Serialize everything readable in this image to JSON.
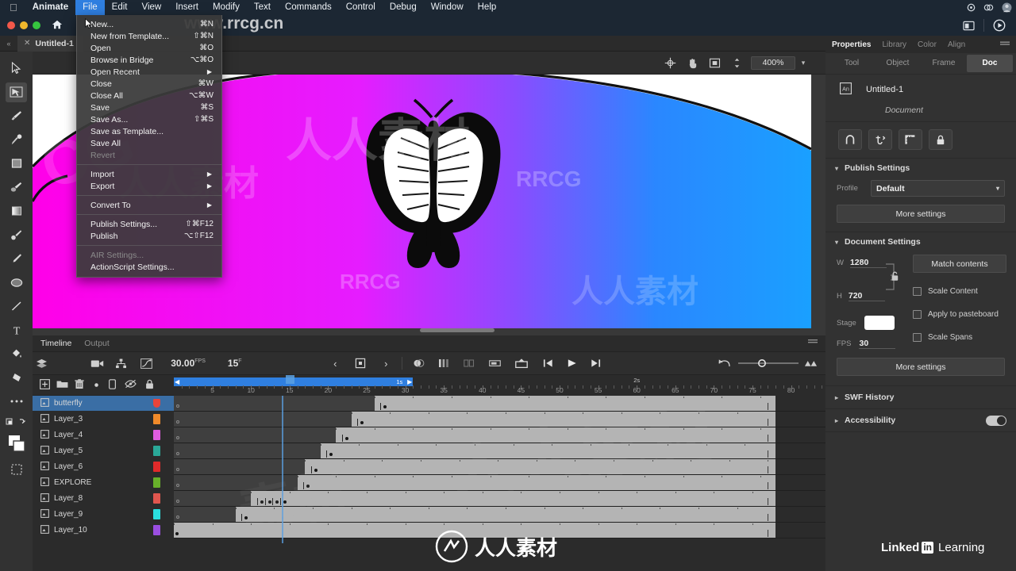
{
  "menubar": {
    "apple_icon": "apple-icon",
    "items": [
      {
        "label": "Animate",
        "bold": true,
        "active": false
      },
      {
        "label": "File",
        "bold": false,
        "active": true
      },
      {
        "label": "Edit",
        "bold": false,
        "active": false
      },
      {
        "label": "View",
        "bold": false,
        "active": false
      },
      {
        "label": "Insert",
        "bold": false,
        "active": false
      },
      {
        "label": "Modify",
        "bold": false,
        "active": false
      },
      {
        "label": "Text",
        "bold": false,
        "active": false
      },
      {
        "label": "Commands",
        "bold": false,
        "active": false
      },
      {
        "label": "Control",
        "bold": false,
        "active": false
      },
      {
        "label": "Debug",
        "bold": false,
        "active": false
      },
      {
        "label": "Window",
        "bold": false,
        "active": false
      },
      {
        "label": "Help",
        "bold": false,
        "active": false
      }
    ],
    "system_icons": [
      "sync-icon",
      "creative-cloud-icon",
      "user-avatar-icon"
    ]
  },
  "file_menu": {
    "items": [
      {
        "label": "New...",
        "shortcut": "⌘N",
        "dim": false,
        "submenu": false,
        "sep_after": false
      },
      {
        "label": "New from Template...",
        "shortcut": "⇧⌘N",
        "dim": false,
        "submenu": false,
        "sep_after": false
      },
      {
        "label": "Open",
        "shortcut": "⌘O",
        "dim": false,
        "submenu": false,
        "sep_after": false
      },
      {
        "label": "Browse in Bridge",
        "shortcut": "⌥⌘O",
        "dim": false,
        "submenu": false,
        "sep_after": false
      },
      {
        "label": "Open Recent",
        "shortcut": "",
        "dim": false,
        "submenu": true,
        "sep_after": false
      },
      {
        "label": "Close",
        "shortcut": "⌘W",
        "dim": false,
        "submenu": false,
        "sep_after": false
      },
      {
        "label": "Close All",
        "shortcut": "⌥⌘W",
        "dim": false,
        "submenu": false,
        "sep_after": false
      },
      {
        "label": "Save",
        "shortcut": "⌘S",
        "dim": false,
        "submenu": false,
        "sep_after": false
      },
      {
        "label": "Save As...",
        "shortcut": "⇧⌘S",
        "dim": false,
        "submenu": false,
        "sep_after": false
      },
      {
        "label": "Save as Template...",
        "shortcut": "",
        "dim": false,
        "submenu": false,
        "sep_after": false
      },
      {
        "label": "Save All",
        "shortcut": "",
        "dim": false,
        "submenu": false,
        "sep_after": false
      },
      {
        "label": "Revert",
        "shortcut": "",
        "dim": true,
        "submenu": false,
        "sep_after": true
      },
      {
        "label": "Import",
        "shortcut": "",
        "dim": false,
        "submenu": true,
        "sep_after": false
      },
      {
        "label": "Export",
        "shortcut": "",
        "dim": false,
        "submenu": true,
        "sep_after": true
      },
      {
        "label": "Convert To",
        "shortcut": "",
        "dim": false,
        "submenu": true,
        "sep_after": true
      },
      {
        "label": "Publish Settings...",
        "shortcut": "⇧⌘F12",
        "dim": false,
        "submenu": false,
        "sep_after": false
      },
      {
        "label": "Publish",
        "shortcut": "⌥⇧F12",
        "dim": false,
        "submenu": false,
        "sep_after": true
      },
      {
        "label": "AIR Settings...",
        "shortcut": "",
        "dim": true,
        "submenu": false,
        "sep_after": false
      },
      {
        "label": "ActionScript Settings...",
        "shortcut": "",
        "dim": false,
        "submenu": false,
        "sep_after": false
      }
    ]
  },
  "appbar": {
    "home_icon": "home-icon",
    "right_icons": [
      "layout-switch-icon",
      "test-movie-play-icon"
    ]
  },
  "doc_tab": {
    "close_icon": "close-icon",
    "title": "Untitled-1"
  },
  "tools": [
    {
      "name": "selection-tool-icon",
      "selected": false
    },
    {
      "name": "free-transform-tool-icon",
      "selected": true
    },
    {
      "name": "brush-tool-icon",
      "selected": false
    },
    {
      "name": "fluid-brush-tool-icon",
      "selected": false
    },
    {
      "name": "rectangle-tool-icon",
      "selected": false
    },
    {
      "name": "paint-brush-tool-icon",
      "selected": false
    },
    {
      "name": "gradient-rect-tool-icon",
      "selected": false
    },
    {
      "name": "classic-brush-tool-icon",
      "selected": false
    },
    {
      "name": "pencil-tool-icon",
      "selected": false
    },
    {
      "name": "oval-tool-icon",
      "selected": false
    },
    {
      "name": "line-tool-icon",
      "selected": false
    },
    {
      "name": "text-tool-icon",
      "selected": false
    },
    {
      "name": "paint-bucket-tool-icon",
      "selected": false
    },
    {
      "name": "eraser-tool-icon",
      "selected": false
    },
    {
      "name": "more-tools-icon",
      "selected": false
    },
    {
      "name": "swap-colors-icon",
      "selected": false
    },
    {
      "name": "fill-stroke-color-icon",
      "selected": false
    },
    {
      "name": "crop-stage-icon",
      "selected": false
    }
  ],
  "stage_toolbar": {
    "icons": [
      "center-stage-icon",
      "hand-tool-icon",
      "fit-stage-icon",
      "zoom-stepper-icon"
    ],
    "zoom_value": "400%",
    "zoom_caret": "chevron-down-icon"
  },
  "timeline": {
    "tabs": [
      {
        "label": "Timeline",
        "active": true
      },
      {
        "label": "Output",
        "active": false
      }
    ],
    "header_icons_left": [
      "layer-parenting-icon",
      "camera-icon",
      "layer-depth-icon",
      "graph-editor-icon"
    ],
    "fps_value": "30.00",
    "fps_suffix": "FPS",
    "current_frame": "15",
    "frame_suffix": "F",
    "nav_icons": [
      "previous-keyframe-icon",
      "insert-keyframe-icon",
      "next-keyframe-icon"
    ],
    "onion_icons": [
      "onion-skin-icon",
      "onion-skin-outline-icon",
      "edit-multiple-frames-icon",
      "modify-onion-markers-icon",
      "loop-playback-icon"
    ],
    "playback_icons": [
      "step-back-icon",
      "play-icon",
      "step-forward-icon"
    ],
    "right_icons": [
      "reset-timeline-icon",
      "frame-size-slider-icon",
      "resize-frames-icon"
    ],
    "layer_tool_icons": [
      "add-layer-icon",
      "new-folder-icon",
      "delete-layer-icon",
      "layer-dot-icon",
      "layer-display-icon",
      "hide-layer-icon",
      "lock-layer-icon"
    ],
    "scrub_range_label": "1s",
    "second_marker_label": "2s",
    "ruler_numbers": [
      5,
      10,
      15,
      20,
      25,
      30,
      35,
      40,
      45,
      50,
      55,
      60,
      65,
      70,
      75,
      80
    ],
    "layers": [
      {
        "name": "butterfly",
        "color": "#e8443a",
        "selected": true,
        "fill_start": 27,
        "keyframes": [
          28
        ]
      },
      {
        "name": "Layer_3",
        "color": "#f08a2a",
        "selected": false,
        "fill_start": 24,
        "keyframes": [
          25
        ]
      },
      {
        "name": "Layer_4",
        "color": "#e05ce0",
        "selected": false,
        "fill_start": 22,
        "keyframes": [
          23
        ]
      },
      {
        "name": "Layer_5",
        "color": "#2aa898",
        "selected": false,
        "fill_start": 20,
        "keyframes": [
          21
        ]
      },
      {
        "name": "Layer_6",
        "color": "#e02a2a",
        "selected": false,
        "fill_start": 18,
        "keyframes": [
          19
        ]
      },
      {
        "name": "EXPLORE",
        "color": "#68b02a",
        "selected": false,
        "fill_start": 17,
        "keyframes": [
          18
        ]
      },
      {
        "name": "Layer_8",
        "color": "#e0564e",
        "selected": false,
        "fill_start": 11,
        "keyframes": [
          12,
          13,
          14,
          15
        ]
      },
      {
        "name": "Layer_9",
        "color": "#2ae0e0",
        "selected": false,
        "fill_start": 9,
        "keyframes": [
          10
        ]
      },
      {
        "name": "Layer_10",
        "color": "#9a4ee0",
        "selected": false,
        "fill_start": 1,
        "keyframes": [
          1
        ]
      }
    ],
    "fill_end_frame": 78,
    "playhead_frame": 15
  },
  "properties": {
    "panel_tabs": [
      {
        "label": "Properties",
        "active": true
      },
      {
        "label": "Library",
        "active": false
      },
      {
        "label": "Color",
        "active": false
      },
      {
        "label": "Align",
        "active": false
      }
    ],
    "menu_icon": "panel-menu-icon",
    "object_tabs": [
      {
        "label": "Tool",
        "active": false
      },
      {
        "label": "Object",
        "active": false
      },
      {
        "label": "Frame",
        "active": false
      },
      {
        "label": "Doc",
        "active": true
      }
    ],
    "doc_icon": "animate-document-icon",
    "doc_name": "Untitled-1",
    "doc_subtitle": "Document",
    "quick_icons": [
      "snap-to-objects-icon",
      "edit-snapping-icon",
      "show-rulers-icon",
      "lock-guides-icon"
    ],
    "publish_settings": {
      "title": "Publish Settings",
      "chevron": "chevron-down-icon",
      "profile_label": "Profile",
      "profile_value": "Default",
      "profile_caret": "chevron-down-icon",
      "more_settings_label": "More settings"
    },
    "document_settings": {
      "title": "Document Settings",
      "chevron": "chevron-down-icon",
      "w_label": "W",
      "w_value": "1280",
      "h_label": "H",
      "h_value": "720",
      "lock_icon": "link-unlocked-icon",
      "stage_label": "Stage",
      "stage_color": "#ffffff",
      "fps_label": "FPS",
      "fps_value": "30",
      "match_contents_label": "Match contents",
      "checkboxes": [
        {
          "label": "Scale Content",
          "checked": false
        },
        {
          "label": "Apply to pasteboard",
          "checked": false
        },
        {
          "label": "Scale Spans",
          "checked": false
        }
      ],
      "more_settings_label": "More settings"
    },
    "collapsed_sections": [
      {
        "label": "SWF History",
        "chevron": "chevron-right-icon",
        "toggle": false
      },
      {
        "label": "Accessibility",
        "chevron": "chevron-right-icon",
        "toggle": true
      }
    ]
  },
  "branding": {
    "linkedin_text_1": "Linked",
    "linkedin_in": "in",
    "linkedin_text_2": "Learning"
  },
  "watermarks": {
    "url": "www.rrcg.cn",
    "marks": [
      "RRCG",
      "RRCG",
      "RRCG",
      "人人素材",
      "人人素材",
      "人人素材"
    ],
    "bottom_text": "人人素材"
  },
  "colors": {
    "accent": "#2f7fe0",
    "menubar_bg": "#1c2733",
    "panel_bg": "#323232",
    "selection_blue": "#3a6ea5"
  }
}
